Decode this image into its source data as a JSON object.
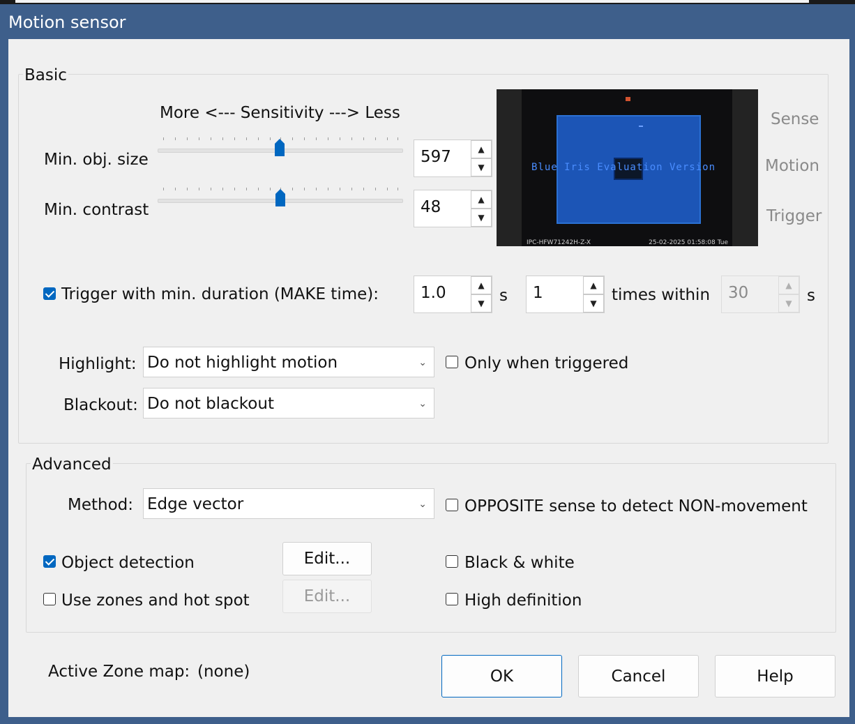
{
  "window": {
    "title": "Motion sensor"
  },
  "basic": {
    "group_label": "Basic",
    "sensitivity_caption": "More <--- Sensitivity ---> Less",
    "min_obj_size": {
      "label": "Min. obj. size",
      "value": "597",
      "slider_fraction": 0.5
    },
    "min_contrast": {
      "label": "Min. contrast",
      "value": "48",
      "slider_fraction": 0.5
    },
    "trigger": {
      "checked": true,
      "label": "Trigger with min. duration (MAKE time):",
      "duration_value": "1.0",
      "duration_unit": "s",
      "times_value": "1",
      "times_label": "times within",
      "within_value": "30",
      "within_unit": "s"
    },
    "highlight": {
      "label": "Highlight:",
      "value": "Do not highlight motion"
    },
    "only_when_triggered": {
      "checked": false,
      "label": "Only when triggered"
    },
    "blackout": {
      "label": "Blackout:",
      "value": "Do not blackout"
    },
    "preview": {
      "watermark": "Blue Iris Evaluation Version",
      "camera_name": "IPC-HFW71242H-Z-X",
      "timestamp": "25-02-2025 01:58:08 Tue"
    },
    "side_labels": {
      "sense": "Sense",
      "motion": "Motion",
      "trigger": "Trigger"
    }
  },
  "advanced": {
    "group_label": "Advanced",
    "method": {
      "label": "Method:",
      "value": "Edge vector"
    },
    "opposite": {
      "checked": false,
      "label": "OPPOSITE sense to detect NON-movement"
    },
    "object_detection": {
      "checked": true,
      "label": "Object detection",
      "edit_label": "Edit..."
    },
    "black_white": {
      "checked": false,
      "label": "Black & white"
    },
    "zones": {
      "checked": false,
      "label": "Use zones and hot spot",
      "edit_label": "Edit..."
    },
    "high_definition": {
      "checked": false,
      "label": "High definition"
    }
  },
  "footer": {
    "active_zone_label": "Active Zone map:",
    "active_zone_value": "(none)",
    "ok": "OK",
    "cancel": "Cancel",
    "help": "Help"
  },
  "colors": {
    "titlebar": "#3e5f8b",
    "accent": "#0067c0",
    "zone": "#1f5fce"
  }
}
